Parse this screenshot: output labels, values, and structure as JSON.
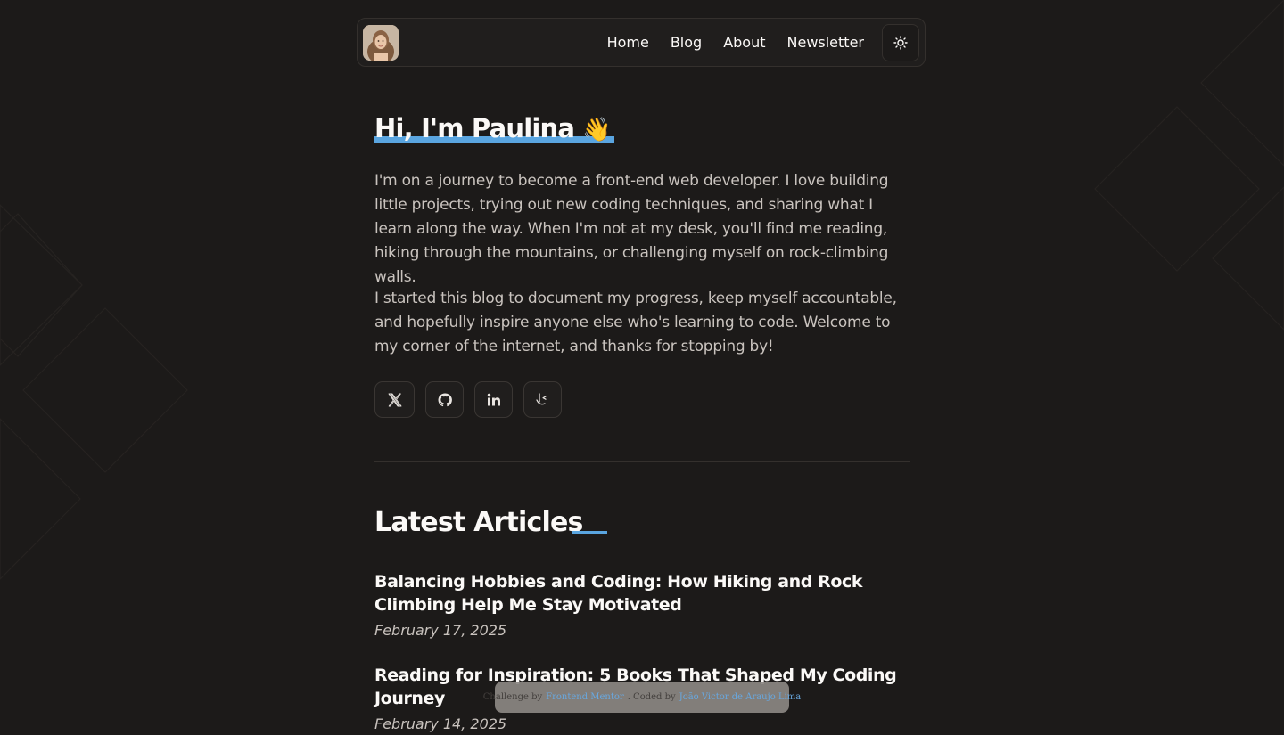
{
  "nav": {
    "avatar_alt": "Paulina avatar",
    "links": [
      {
        "label": "Home"
      },
      {
        "label": "Blog"
      },
      {
        "label": "About"
      },
      {
        "label": "Newsletter"
      }
    ],
    "theme_toggle_icon": "sun-icon"
  },
  "hero": {
    "title": "Hi, I'm Paulina",
    "emoji": "👋",
    "paragraph_1": "I'm on a journey to become a front-end web developer. I love building little projects, trying out new coding techniques, and sharing what I learn along the way. When I'm not at my desk, you'll find me reading, hiking through the mountains, or challenging myself on rock-climbing walls.",
    "paragraph_2": "I started this blog to document my progress, keep myself accountable, and hopefully inspire anyone else who's learning to code. Welcome to my corner of the internet, and thanks for stopping by!"
  },
  "socials": [
    {
      "icon": "x-icon"
    },
    {
      "icon": "github-icon"
    },
    {
      "icon": "linkedin-icon"
    },
    {
      "icon": "frontend-mentor-icon"
    }
  ],
  "latest": {
    "title": "Latest Articles",
    "articles": [
      {
        "title": "Balancing Hobbies and Coding: How Hiking and Rock Climbing Help Me Stay Motivated",
        "date": "February 17, 2025"
      },
      {
        "title": "Reading for Inspiration: 5 Books That Shaped My Coding Journey",
        "date": "February 14, 2025"
      }
    ]
  },
  "attribution": {
    "prefix": "Challenge by",
    "challenge_link": "Frontend Mentor",
    "middle": ". Coded by",
    "author_link": "João Victor de Araujo Lima"
  },
  "colors": {
    "background": "#1c1a19",
    "accent": "#5aa5e0",
    "text": "#fbf9f7",
    "muted_text": "#c9c3be"
  }
}
